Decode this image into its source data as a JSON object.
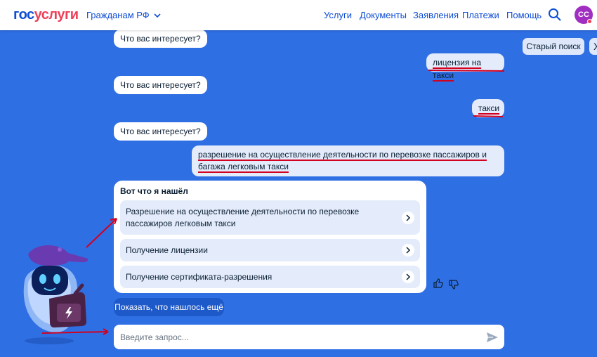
{
  "header": {
    "logo_part1": "гос",
    "logo_part2": "услуги",
    "audience": "Гражданам РФ",
    "nav": [
      "Услуги",
      "Документы",
      "Заявления",
      "Платежи",
      "Помощь"
    ],
    "avatar_initials": "СС"
  },
  "side": {
    "old_search": "Старый поиск",
    "close_glyph": "X"
  },
  "chat": {
    "bot_question": "Что вас интересует?",
    "user_messages": [
      "лицензия на такси",
      "такси",
      "разрешение на осуществление деятельности по перевозке пассажиров и багажа легковым такси"
    ]
  },
  "result": {
    "title": "Вот что я нашёл",
    "options": [
      "Разрешение на осуществление деятельности по перевозке пассажиров легковым такси",
      "Получение лицензии",
      "Получение сертификата-разрешения"
    ],
    "show_more": "Показать, что нашлось ещё"
  },
  "input": {
    "placeholder": "Введите запрос...",
    "value": ""
  },
  "colors": {
    "background": "#2f6fe4",
    "brand_blue": "#0d4cd3",
    "brand_red": "#ee3f58",
    "annotation_red": "#d4001f"
  },
  "icons": [
    "chevron-down-icon",
    "search-icon",
    "chevron-right-icon",
    "thumbs-up-icon",
    "thumbs-down-icon",
    "send-icon",
    "robot-mascot-icon"
  ]
}
